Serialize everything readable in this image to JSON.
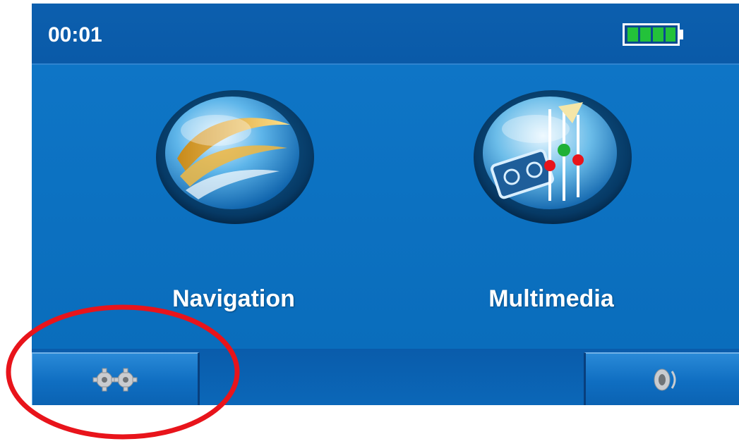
{
  "status_bar": {
    "time": "00:01",
    "battery_icon": "battery-full-icon",
    "battery_color": "#23c23a"
  },
  "apps": [
    {
      "label": "Navigation",
      "icon": "navigation-icon"
    },
    {
      "label": "Multimedia",
      "icon": "multimedia-icon"
    }
  ],
  "bottom_bar": {
    "settings_icon": "settings-gears-icon",
    "volume_icon": "speaker-icon"
  },
  "annotation": {
    "shape": "ellipse",
    "color": "#e8141b",
    "marks": "settings-button"
  },
  "colors": {
    "screen_background": "#0b6fc0",
    "bar_background": "#0a5aa8",
    "label_text": "#ffffff"
  }
}
